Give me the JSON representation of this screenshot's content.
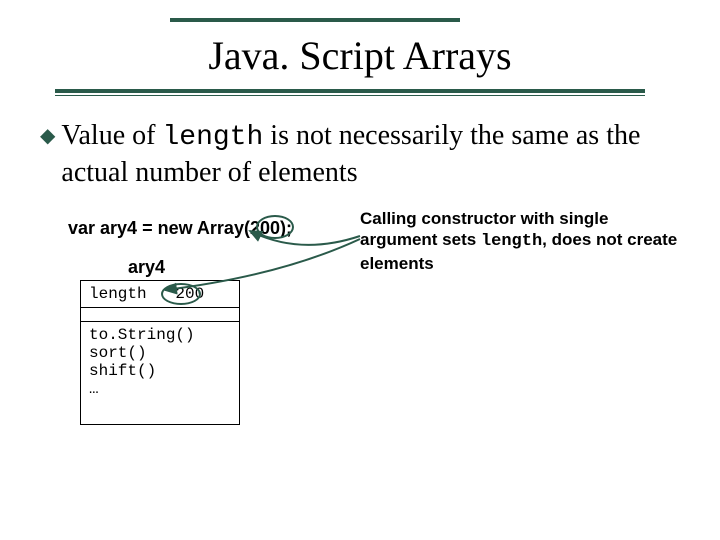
{
  "title": "Java. Script Arrays",
  "bullet": {
    "prefix": "Value of ",
    "code": "length",
    "suffix": " is not necessarily the same as the actual number of elements"
  },
  "code_line": {
    "before_paren": "var ary4 = new Array(",
    "arg": "200",
    "after_paren": ");"
  },
  "note": {
    "line1": "Calling constructor with single argument sets ",
    "code": "length",
    "line2": ", does not create elements"
  },
  "object": {
    "label": "ary4",
    "prop_name": "length",
    "prop_value": "200",
    "methods": [
      "to.String()",
      "sort()",
      "shift()",
      "…"
    ]
  },
  "colors": {
    "accent": "#2a5a4a"
  }
}
